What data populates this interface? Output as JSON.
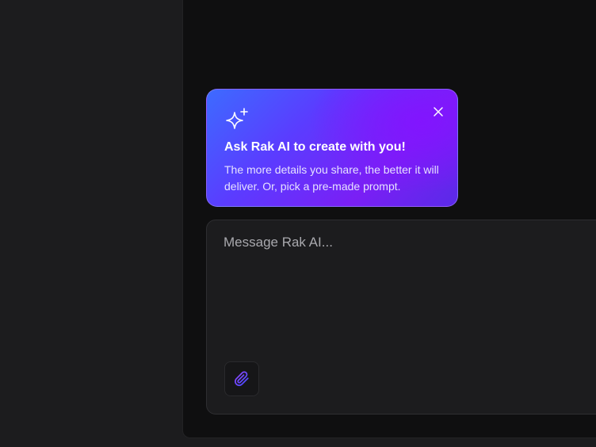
{
  "promo": {
    "title": "Ask Rak AI to create with you!",
    "body": "The more details you share, the better it will deliver. Or, pick a pre-made prompt.",
    "icon": "sparkle-icon",
    "close_icon": "close-icon"
  },
  "composer": {
    "placeholder": "Message Rak AI...",
    "value": "",
    "attach_icon": "paperclip-icon"
  },
  "colors": {
    "page_background": "#1c1c1e",
    "panel_background": "#0f0f10",
    "promo_gradient_start": "#3d6bff",
    "promo_gradient_end": "#7a1ff5",
    "attach_icon_gradient": [
      "#8a3dff",
      "#3d4bff"
    ]
  }
}
